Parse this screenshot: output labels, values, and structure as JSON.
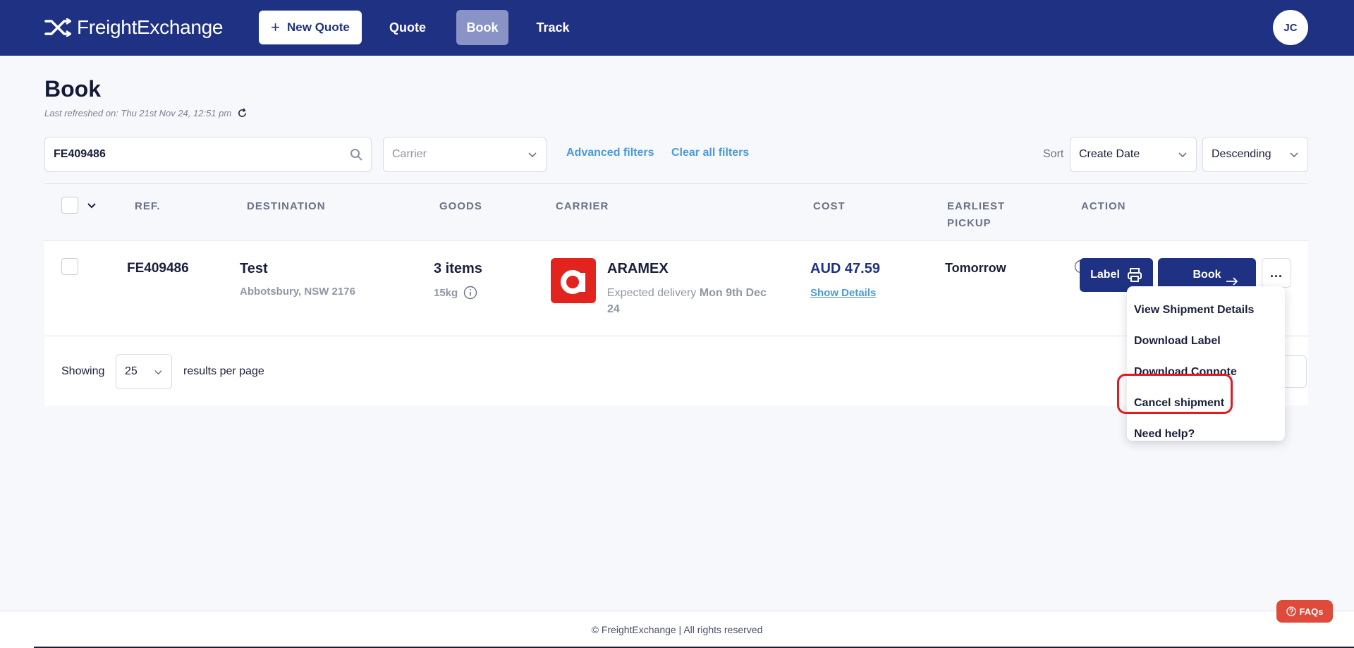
{
  "nav": {
    "brand": "FreightExchange",
    "new_quote": "New Quote",
    "quote": "Quote",
    "book": "Book",
    "track": "Track",
    "avatar_initials": "JC",
    "bar_color": "#1f3182"
  },
  "header": {
    "title": "Book",
    "last_refreshed": "Last refreshed on: Thu 21st Nov 24, 12:51 pm"
  },
  "filters": {
    "search_value": "FE409486",
    "carrier_placeholder": "Carrier",
    "advanced_filters": "Advanced filters",
    "clear_all": "Clear all filters",
    "sort_label": "Sort",
    "sort_field": "Create Date",
    "sort_order": "Descending"
  },
  "table": {
    "columns": [
      "REF.",
      "DESTINATION",
      "GOODS",
      "CARRIER",
      "COST",
      "EARLIEST PICKUP",
      "ACTION"
    ],
    "rows": [
      {
        "ref": "FE409486",
        "destination_name": "Test",
        "destination_address": "Abbotsbury, NSW 2176",
        "goods_count": "3 items",
        "goods_weight": "15kg",
        "carrier_name": "ARAMEX",
        "carrier_logo_color": "#e3231d",
        "expected_delivery_label": "Expected delivery",
        "expected_delivery_date": "Mon 9th Dec 24",
        "cost": "AUD 47.59",
        "show_details": "Show Details",
        "earliest_pickup": "Tomorrow",
        "label_button": "Label",
        "book_button": "Book",
        "more_button": "..."
      }
    ],
    "showing_label": "Showing",
    "per_page": "25",
    "results_per_page": "results per page"
  },
  "action_menu": {
    "items": [
      "View Shipment Details",
      "Download Label",
      "Download Connote",
      "Cancel shipment",
      "Need help?"
    ],
    "highlighted": "Cancel shipment",
    "highlight_color": "#e11b22"
  },
  "footer": {
    "copyright": "© FreightExchange | All rights reserved",
    "faq": "FAQs"
  }
}
